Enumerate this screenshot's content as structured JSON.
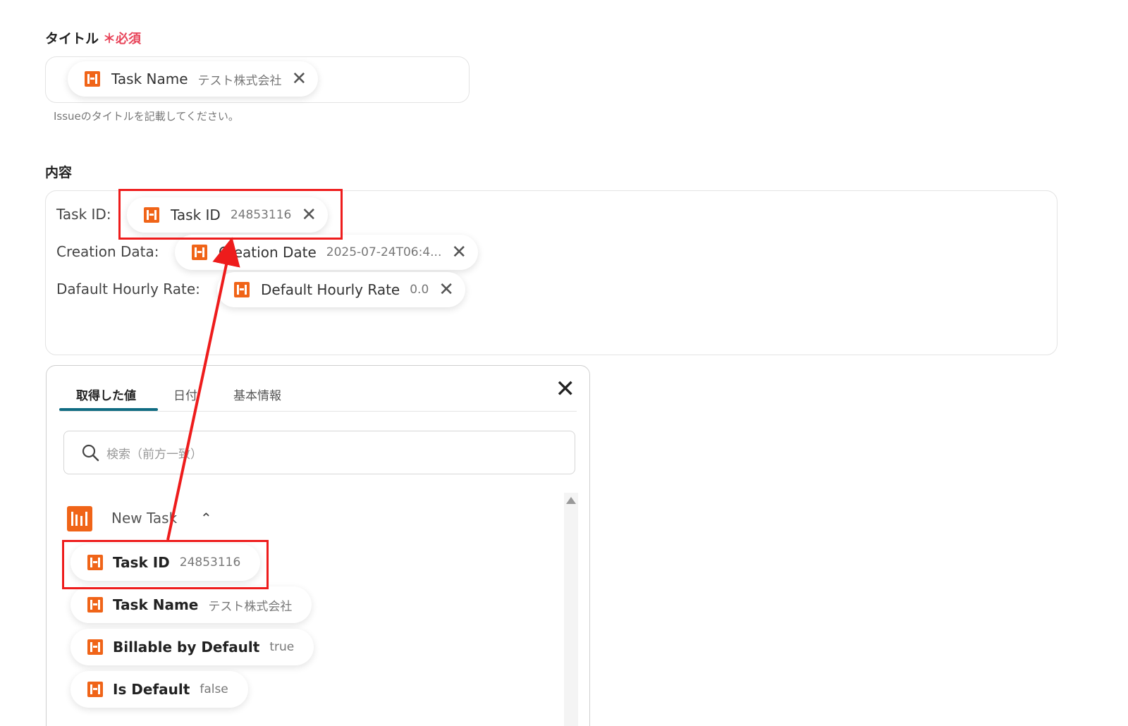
{
  "title_field": {
    "label": "タイトル",
    "required_mark": "＊必須",
    "chip": {
      "label": "Task Name",
      "value": "テスト株式会社",
      "remove": "✕"
    },
    "hint": "Issueのタイトルを記載してください。"
  },
  "content_field": {
    "label": "内容",
    "rows": [
      {
        "label": "Task ID:",
        "chip_label": "Task ID",
        "chip_value": "24853116"
      },
      {
        "label": "Creation Data:",
        "chip_label": "Creation Date",
        "chip_value": "2025-07-24T06:4..."
      },
      {
        "label": "Dafault Hourly Rate:",
        "chip_label": "Default Hourly Rate",
        "chip_value": "0.0"
      }
    ],
    "remove": "✕"
  },
  "picker": {
    "tabs": [
      "取得した値",
      "日付",
      "基本情報"
    ],
    "active_tab": 0,
    "close": "✕",
    "search_placeholder": "検索（前方一致）",
    "group": {
      "title": "New Task",
      "chevron": "⌃"
    },
    "options": [
      {
        "label": "Task ID",
        "value": "24853116"
      },
      {
        "label": "Task Name",
        "value": "テスト株式会社"
      },
      {
        "label": "Billable by Default",
        "value": "true"
      },
      {
        "label": "Is Default",
        "value": "false"
      }
    ]
  },
  "colors": {
    "accent": "#0f6b82",
    "harvest_orange": "#f06418",
    "required": "#e8455a",
    "annotation_red": "#ee1c1c"
  },
  "icons": [
    "harvest-icon",
    "close-icon",
    "search-icon",
    "chevron-up-icon",
    "scroll-up-icon"
  ]
}
